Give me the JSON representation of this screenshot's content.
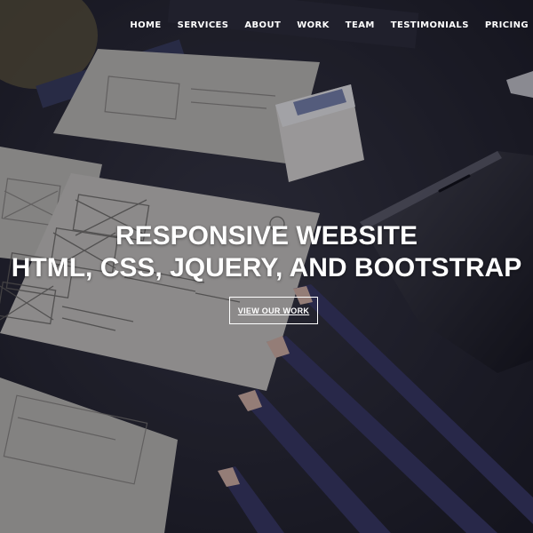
{
  "nav": {
    "items": [
      {
        "label": "HOME"
      },
      {
        "label": "SERVICES"
      },
      {
        "label": "ABOUT"
      },
      {
        "label": "WORK"
      },
      {
        "label": "TEAM"
      },
      {
        "label": "TESTIMONIALS"
      },
      {
        "label": "PRICING"
      }
    ]
  },
  "hero": {
    "headline_line1": "RESPONSIVE WEBSITE",
    "headline_line2": "HTML, CSS, JQUERY, AND BOOTSTRAP",
    "cta_label": "VIEW OUR WORK",
    "background_description_colors": {
      "desk": "#26262f",
      "paper": "#d9d6cf",
      "pencil": "#3a3a6a",
      "pencil_tip": "#e8c3b4"
    }
  }
}
